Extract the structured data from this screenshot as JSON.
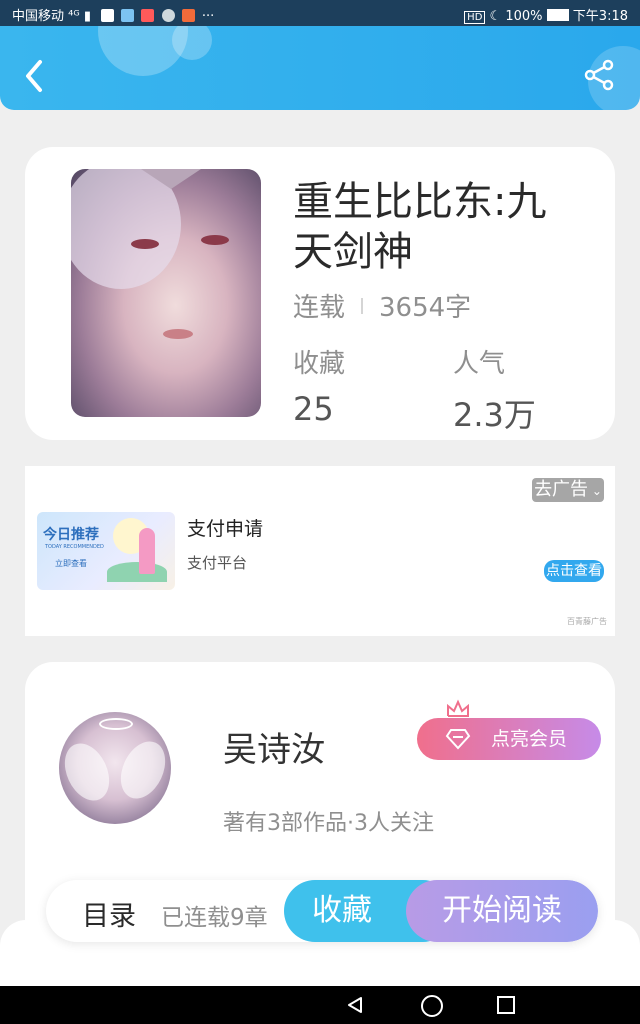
{
  "status_bar": {
    "carrier": "中国移动",
    "network": "⁴ᴳ",
    "battery": "100%",
    "time": "下午3:18",
    "more": "···"
  },
  "header": {
    "back_icon": "chevron-left-icon",
    "share_icon": "share-icon",
    "accent_color": "#2aa8ec"
  },
  "book": {
    "title": "重生比比东:九天剑神",
    "status": "连载",
    "word_count": "3654字",
    "stats": [
      {
        "label": "收藏",
        "value": "25"
      },
      {
        "label": "人气",
        "value": "2.3万"
      }
    ]
  },
  "ad": {
    "close_label": "去广告",
    "image_title": "今日推荐",
    "image_subtitle": "TODAY RECOMMENDED",
    "image_cta": "立即查看",
    "title": "支付申请",
    "subtitle": "支付平台",
    "action": "点击查看",
    "source": "百青藤广告"
  },
  "author": {
    "name": "吴诗汝",
    "stats": "著有3部作品·3人关注",
    "vip_button": "点亮会员"
  },
  "action_bar": {
    "toc": "目录",
    "chapters": "已连载9章",
    "favorite": "收藏",
    "read": "开始阅读"
  }
}
